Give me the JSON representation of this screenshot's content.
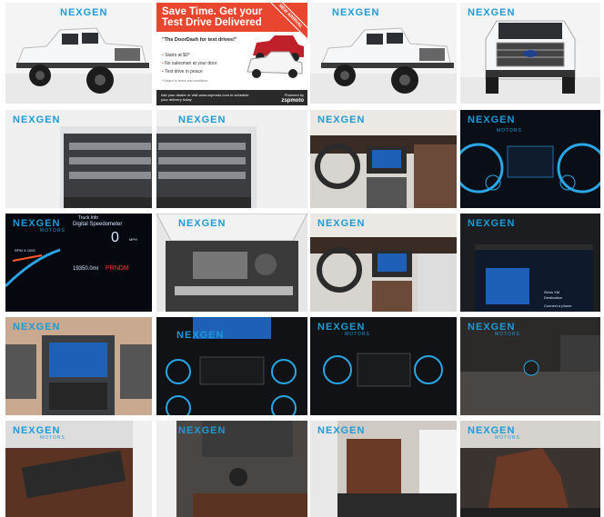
{
  "gallery": {
    "logo_text": "NEXGEN",
    "logo_subtext": "MOTORS"
  },
  "ad": {
    "headline": "Save Time. Get your Test Drive Delivered",
    "ribbon": "NEW ARRIVAL",
    "quote": "\"The DoorDash for test drives!\"",
    "bullets": [
      "Starts at $0*",
      "No salesman at your door",
      "Test drive in peace"
    ],
    "fine_print": "*Subject to terms and conditions",
    "footer_left": "Ask your dealer or visit www.zspmoto.com to schedule your delivery today",
    "footer_right_1": "Powered by",
    "footer_right_2": "zspmoto"
  },
  "speedometer": {
    "title": "Digital Speedometer",
    "tab": "Truck Info",
    "speed": "0",
    "unit": "MPH",
    "odometer": "19350.0mi",
    "gear": "PRNDM",
    "rpm_label": "RPM X 1000"
  },
  "screen": {
    "label_1": "Sirius XM",
    "label_2": "Destination",
    "connect": "Connect a phone"
  },
  "colors": {
    "brand": "#1d9bd7",
    "ad_red": "#e8462e",
    "truck_white": "#f2f3f5",
    "leather": "#5b3322"
  }
}
